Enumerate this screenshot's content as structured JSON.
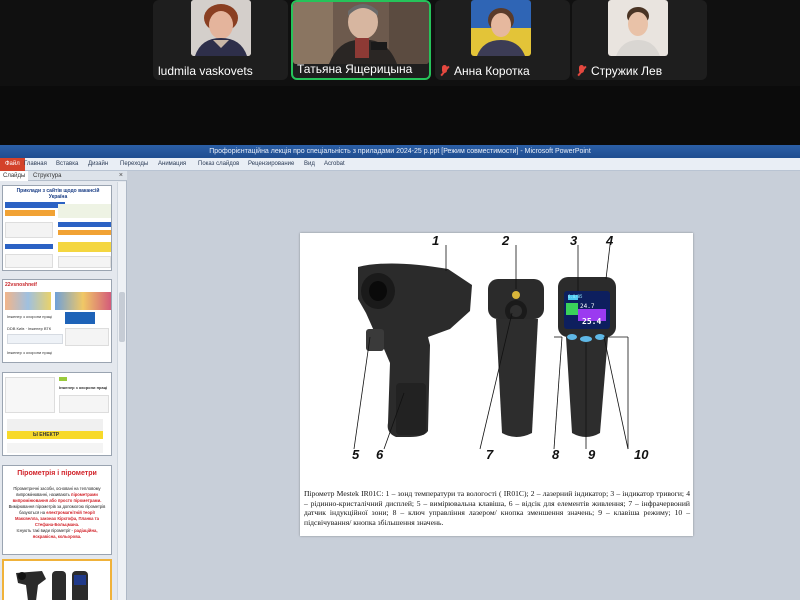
{
  "call": {
    "participants": [
      {
        "name": "ludmila vaskovets",
        "muted": false,
        "active": false
      },
      {
        "name": "Татьяна Ящерицына",
        "muted": false,
        "active": true
      },
      {
        "name": "Анна Коротка",
        "muted": true,
        "active": false
      },
      {
        "name": "Стружик Лев",
        "muted": true,
        "active": false
      }
    ]
  },
  "window": {
    "title": "Профорієнтаційна лекція про  спеціальність з приладами 2024-25 р.ppt [Режим совместимости] - Microsoft PowerPoint"
  },
  "ribbon": {
    "tabs": [
      "Файл",
      "Главная",
      "Вставка",
      "Дизайн",
      "Переходы",
      "Анимация",
      "Показ слайдов",
      "Рецензирование",
      "Вид",
      "Acrobat"
    ]
  },
  "pane": {
    "tabs": [
      "Слайды",
      "Структура"
    ],
    "close": "×",
    "thumb1": {
      "title": "Приклади з сайтів щодо вакансій Україна"
    },
    "thumb2": {
      "logo": "22vsnoshneif",
      "lines": [
        "Інженер з охорони праці",
        "DDB Київ · Інженер ВТК",
        "Інженер з охорони праці"
      ]
    },
    "thumb3": {
      "lines": [
        "Інженер з охорони праці",
        "Ы ЕНЕКТР"
      ]
    },
    "thumb4": {
      "title": "Пірометрія і пірометри",
      "text1": "Пірометричні засоби, основані на тепловому випромінюванні, називають",
      "text1r": "пірометрами випромінювання або просто пірометрами.",
      "text2": "Вимірювання пірометрів за допомогою пірометрів базуються на",
      "text2r": "електромагнітній теорії Максвелла, законах Кірхгофа, Планка та Стефана-Больцмана.",
      "text3": "Існують такі види пірометрії -",
      "text3r": "радіаційна, яскравісна, кольорова."
    }
  },
  "slide": {
    "labels": [
      "1",
      "2",
      "3",
      "4",
      "5",
      "6",
      "7",
      "8",
      "9",
      "10"
    ],
    "display": [
      "6.0/85",
      "24.7",
      "25.4"
    ],
    "caption": "Пірометр Mestek IR01C: 1 – зонд температури та вологості ( IR01C); 2 – лазерний індикатор; 3 – індикатор тривоги; 4 – рідинно-кристалічний дисплей; 5 – вимірювальна клавіша, 6 – відсік для елементів живлення; 7 – інфрачервоний датчик індукційної зони; 8 – ключ управління лазером/ кнопка зменшення значень; 9 – клавіша режиму; 10 – підсвічування/ кнопка збільшення значень."
  },
  "colors": {
    "active_border": "#26c35a",
    "muted_icon": "#e5483f",
    "title_bar": "#2b5fa7",
    "file_tab": "#d3422a",
    "thumb_title_red": "#d2232a"
  }
}
